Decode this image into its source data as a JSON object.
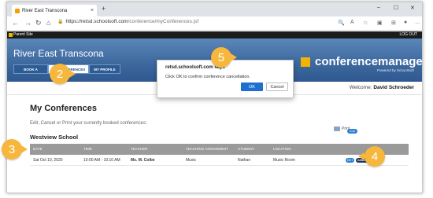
{
  "browser": {
    "tab_title": "River East Transcona",
    "tab_close": "×",
    "new_tab": "+",
    "url_host": "https://retsd.schoolsoft.com",
    "url_path": "/conference/myConferences.jsf",
    "window_controls": [
      "–",
      "☐",
      "✕"
    ]
  },
  "site": {
    "bar_label": "Parent Site",
    "logout": "LOG OUT",
    "school_name": "River East Transcona",
    "nav": [
      {
        "label": "BOOK A"
      },
      {
        "label": "MY CONFERENCES"
      },
      {
        "label": "MY PROFILE"
      }
    ],
    "brand": "conferencemanager",
    "brand_sub": "Powered by SchoolSoft"
  },
  "welcome": {
    "prefix": "Welcome:",
    "name": "David Schroeder"
  },
  "main": {
    "title": "My Conferences",
    "intro": "Edit, Cancel or Print your currently booked conferences:",
    "print_label": "Print",
    "ical_label": "iCal",
    "section": "Westview School",
    "columns": [
      "DATE",
      "TIME",
      "TEACHER",
      "TEACHING ASSIGNMENT",
      "STUDENT",
      "LOCATION"
    ],
    "rows": [
      {
        "date": "Sat Oct 10, 2020",
        "time": "10:00 AM - 10:10 AM",
        "teacher": "Ms. M. Colbe",
        "assignment": "Music",
        "student": "Nathan",
        "location": "Music Room",
        "edit": "EDIT",
        "cancel": "CANCEL APPT"
      }
    ]
  },
  "dialog": {
    "title": "retsd.schoolsoft.com says",
    "message": "Click OK to confirm conference cancellation.",
    "ok": "OK",
    "cancel": "Cancel"
  },
  "steps": [
    "2",
    "3",
    "4",
    "5"
  ],
  "colors": {
    "step_marker": "#f6b73c",
    "banner": "#3e6aa0",
    "ok_button": "#1e6fd0"
  }
}
